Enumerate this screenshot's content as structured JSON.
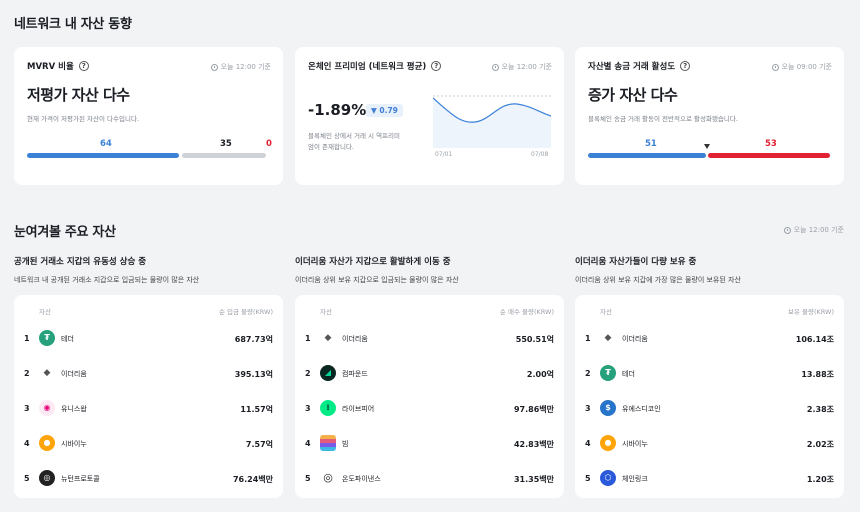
{
  "header": {
    "title": "네트워크 내 자산 동향"
  },
  "metrics": [
    {
      "title": "MVRV 비율",
      "time": "오늘 12:00 기준",
      "headline": "저평가 자산 다수",
      "desc": "현재 가격이 저평가된 자산이 다수입니다.",
      "blue": "64",
      "gray": "35",
      "red": "0"
    },
    {
      "title": "온체인 프리미엄 (네트워크 평균)",
      "time": "오늘 12:00 기준",
      "value": "-1.89%",
      "change": "▼ 0.79",
      "desc1": "블록체인 상에서 거래 시 역프리미",
      "desc2": "엄이 존재합니다.",
      "x_start": "07/01",
      "x_end": "07/08"
    },
    {
      "title": "자산별 송금 거래 활성도",
      "time": "오늘 09:00 기준",
      "headline": "증가 자산 다수",
      "desc": "블록체인 송금 거래 활동이 전반적으로 활성화됐습니다.",
      "blue": "51",
      "red": "53"
    }
  ],
  "section2": {
    "title": "눈여겨볼 주요 자산",
    "time": "오늘 12:00 기준"
  },
  "columns": [
    {
      "title": "공개된 거래소 지갑의 유동성 상승 중",
      "subtitle": "네트워크 내 공개된 거래소 지갑으로 입금되는 물량이 많은 자산",
      "h_asset": "자산",
      "h_value": "순 입금 물량(KRW)",
      "rows": [
        {
          "rank": "1",
          "name": "테더",
          "value": "687.73억",
          "icon": "tether-icon",
          "glyph": "₮",
          "color": "#26a17b"
        },
        {
          "rank": "2",
          "name": "이더리움",
          "value": "395.13억",
          "icon": "ethereum-icon",
          "glyph": "◆",
          "color": "#ffffff"
        },
        {
          "rank": "3",
          "name": "유니스왑",
          "value": "11.57억",
          "icon": "uniswap-icon",
          "glyph": "🦄",
          "color": "#fde9f3"
        },
        {
          "rank": "4",
          "name": "시바이누",
          "value": "7.57억",
          "icon": "shiba-icon",
          "glyph": "🐕",
          "color": "#fff0e0"
        },
        {
          "rank": "5",
          "name": "뉴턴프로토콜",
          "value": "76.24백만",
          "icon": "newton-icon",
          "glyph": "N",
          "color": "#222222"
        }
      ]
    },
    {
      "title": "이더리움 자산가 지갑으로 활발하게 이동 중",
      "subtitle": "이더리움 상위 보유 지갑으로 입금되는 물량이 많은 자산",
      "h_asset": "자산",
      "h_value": "순 매수 물량(KRW)",
      "rows": [
        {
          "rank": "1",
          "name": "이더리움",
          "value": "550.51억",
          "icon": "ethereum-icon",
          "glyph": "◆",
          "color": "#ffffff"
        },
        {
          "rank": "2",
          "name": "컴파운드",
          "value": "2.00억",
          "icon": "compound-icon",
          "glyph": "◢",
          "color": "#0a2620"
        },
        {
          "rank": "3",
          "name": "라이브피어",
          "value": "97.86백만",
          "icon": "livepeer-icon",
          "glyph": "⁞",
          "color": "#00eb88"
        },
        {
          "rank": "4",
          "name": "빔",
          "value": "42.83백만",
          "icon": "beam-icon",
          "glyph": "≡",
          "color": "#f6b04a"
        },
        {
          "rank": "5",
          "name": "온도파이낸스",
          "value": "31.35백만",
          "icon": "ondo-icon",
          "glyph": "◎",
          "color": "#ffffff"
        }
      ]
    },
    {
      "title": "이더리움 자산가들이 다량 보유 중",
      "subtitle": "이더리움 상위 보유 지갑에 가장 많은 물량이 보유된 자산",
      "h_asset": "자산",
      "h_value": "보유 물량(KRW)",
      "rows": [
        {
          "rank": "1",
          "name": "이더리움",
          "value": "106.14조",
          "icon": "ethereum-icon",
          "glyph": "◆",
          "color": "#ffffff"
        },
        {
          "rank": "2",
          "name": "테더",
          "value": "13.88조",
          "icon": "tether-icon",
          "glyph": "₮",
          "color": "#26a17b"
        },
        {
          "rank": "3",
          "name": "유에스디코인",
          "value": "2.38조",
          "icon": "usdc-icon",
          "glyph": "$",
          "color": "#2775ca"
        },
        {
          "rank": "4",
          "name": "시바이누",
          "value": "2.02조",
          "icon": "shiba-icon",
          "glyph": "🐕",
          "color": "#fff0e0"
        },
        {
          "rank": "5",
          "name": "체인링크",
          "value": "1.20조",
          "icon": "chainlink-icon",
          "glyph": "⬡",
          "color": "#2a5ada"
        }
      ]
    }
  ],
  "colors": {
    "blue": "#3b82d6",
    "red": "#e02232",
    "gray": "#cfd3d8"
  }
}
